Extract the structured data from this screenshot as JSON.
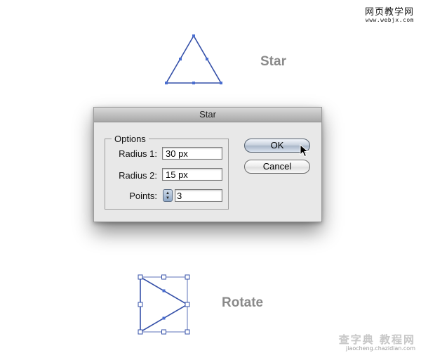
{
  "watermark_top": {
    "chinese": "网页教学网",
    "url": "www.webjx.com"
  },
  "watermark_bottom": {
    "chinese": "查字典 教程网",
    "url": "jiaocheng.chazidian.com"
  },
  "labels": {
    "star": "Star",
    "rotate": "Rotate"
  },
  "dialog": {
    "title": "Star",
    "group_label": "Options",
    "radius1": {
      "label": "Radius 1:",
      "value": "30 px"
    },
    "radius2": {
      "label": "Radius 2:",
      "value": "15 px"
    },
    "points": {
      "label": "Points:",
      "value": "3"
    },
    "ok_label": "OK",
    "cancel_label": "Cancel"
  },
  "colors": {
    "shape_stroke": "#3550a8",
    "anchor_fill": "#4a6ed0",
    "label_gray": "#8a8a8a"
  }
}
